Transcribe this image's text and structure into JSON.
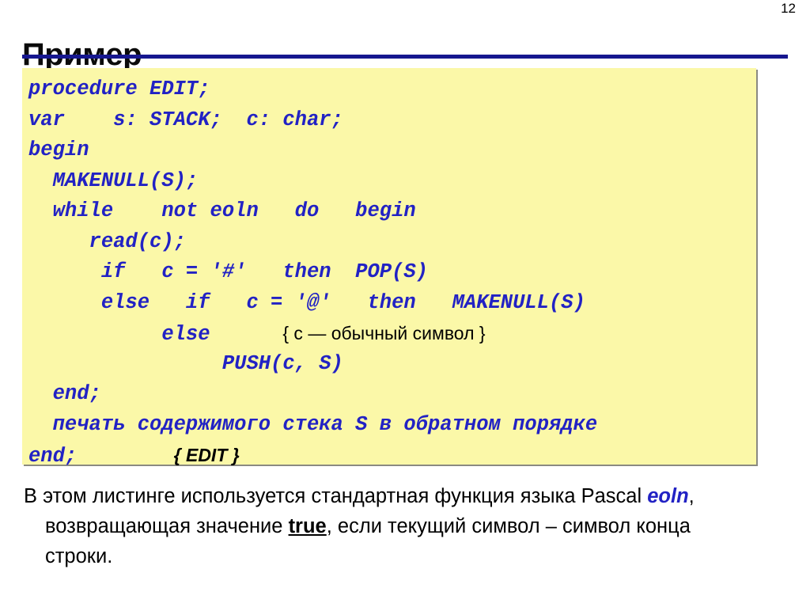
{
  "slide": {
    "number": "12",
    "title": "Пример"
  },
  "theme": {
    "title_color": "#0b0b0b",
    "rule_color": "#16178f",
    "code_bg": "#fbf8a8",
    "code_color": "#2222c4",
    "comment_color": "#000000",
    "shadow_color": "#8a8a82"
  },
  "code": {
    "language": "Pascal",
    "lines": [
      "procedure EDIT;",
      "var    s: STACK;  c: char;",
      "begin",
      "  MAKENULL(S);",
      "  while    not eoln   do   begin",
      "     read(c);",
      "      if   c = '#'   then  POP(S)",
      "      else   if   c = '@'   then   MAKENULL(S)",
      "           else       { c — обычный символ }",
      "                PUSH(c, S)",
      "  end;",
      "  печать содержимого стека S в обратном порядке",
      "end;         { EDIT }"
    ],
    "line_parts": [
      [
        {
          "t": "procedure EDIT;",
          "s": "code"
        }
      ],
      [
        {
          "t": "var    s: STACK;  c: char;",
          "s": "code"
        }
      ],
      [
        {
          "t": "begin",
          "s": "code"
        }
      ],
      [
        {
          "t": "  MAKENULL(S);",
          "s": "code"
        }
      ],
      [
        {
          "t": "  while    not eoln   do   begin",
          "s": "code"
        }
      ],
      [
        {
          "t": "     read(c);",
          "s": "code"
        }
      ],
      [
        {
          "t": "      if   c = '#'   then  POP(S)",
          "s": "code"
        }
      ],
      [
        {
          "t": "      else   if   c = '@'   then   MAKENULL(S)",
          "s": "code"
        }
      ],
      [
        {
          "t": "           else      ",
          "s": "code"
        },
        {
          "t": "{ c — обычный символ }",
          "s": "comment"
        }
      ],
      [
        {
          "t": "                PUSH(c, S)",
          "s": "code"
        }
      ],
      [
        {
          "t": "  end;",
          "s": "code"
        }
      ],
      [
        {
          "t": "  печать содержимого стека S в обратном порядке",
          "s": "code"
        }
      ],
      [
        {
          "t": "end;        ",
          "s": "code"
        },
        {
          "t": "{ EDIT }",
          "s": "comment-bold"
        }
      ]
    ]
  },
  "body": {
    "line1": [
      {
        "t": "В этом листинге используется стандартная функция языка Pascal ",
        "s": "plain"
      },
      {
        "t": "eoln",
        "s": "blue-bold-italic"
      },
      {
        "t": ",",
        "s": "plain"
      }
    ],
    "line2": [
      {
        "t": "возвращающая значение ",
        "s": "plain"
      },
      {
        "t": "true",
        "s": "bold-underline"
      },
      {
        "t": ", если текущий символ – символ конца",
        "s": "plain"
      }
    ],
    "line3": [
      {
        "t": "строки.",
        "s": "plain"
      }
    ]
  }
}
